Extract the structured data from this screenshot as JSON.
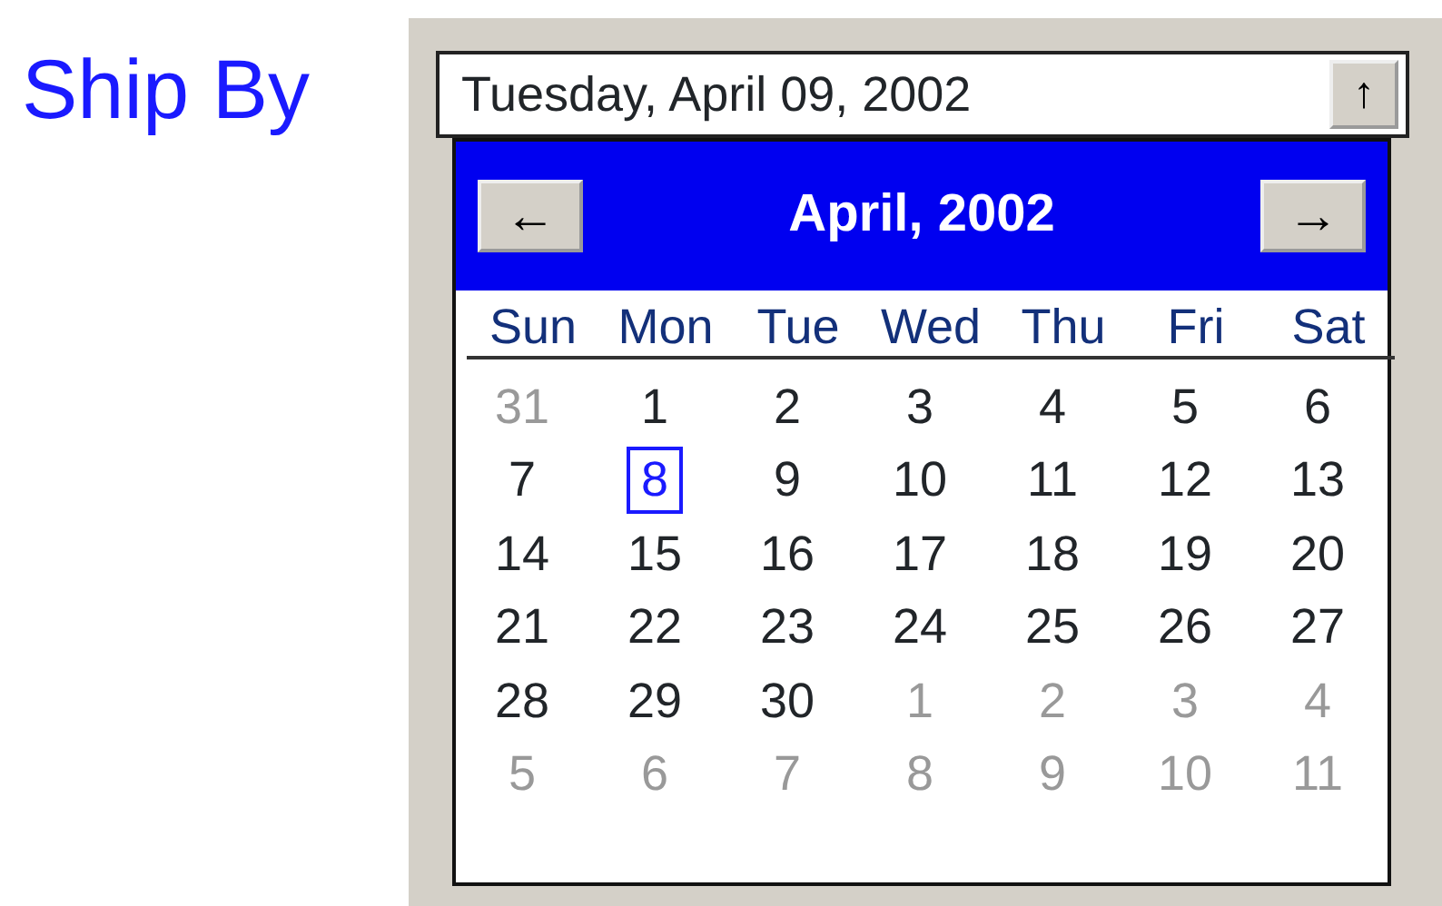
{
  "label": "Ship By",
  "field": {
    "value": "Tuesday, April 09, 2002",
    "button": "↑"
  },
  "calendar": {
    "title": "April, 2002",
    "prev": "←",
    "next": "→",
    "weekdays": [
      "Sun",
      "Mon",
      "Tue",
      "Wed",
      "Thu",
      "Fri",
      "Sat"
    ],
    "days": [
      {
        "text": "31",
        "muted": true,
        "today": false
      },
      {
        "text": "1",
        "muted": false,
        "today": false
      },
      {
        "text": "2",
        "muted": false,
        "today": false
      },
      {
        "text": "3",
        "muted": false,
        "today": false
      },
      {
        "text": "4",
        "muted": false,
        "today": false
      },
      {
        "text": "5",
        "muted": false,
        "today": false
      },
      {
        "text": "6",
        "muted": false,
        "today": false
      },
      {
        "text": "7",
        "muted": false,
        "today": false
      },
      {
        "text": "8",
        "muted": false,
        "today": true
      },
      {
        "text": "9",
        "muted": false,
        "today": false
      },
      {
        "text": "10",
        "muted": false,
        "today": false
      },
      {
        "text": "11",
        "muted": false,
        "today": false
      },
      {
        "text": "12",
        "muted": false,
        "today": false
      },
      {
        "text": "13",
        "muted": false,
        "today": false
      },
      {
        "text": "14",
        "muted": false,
        "today": false
      },
      {
        "text": "15",
        "muted": false,
        "today": false
      },
      {
        "text": "16",
        "muted": false,
        "today": false
      },
      {
        "text": "17",
        "muted": false,
        "today": false
      },
      {
        "text": "18",
        "muted": false,
        "today": false
      },
      {
        "text": "19",
        "muted": false,
        "today": false
      },
      {
        "text": "20",
        "muted": false,
        "today": false
      },
      {
        "text": "21",
        "muted": false,
        "today": false
      },
      {
        "text": "22",
        "muted": false,
        "today": false
      },
      {
        "text": "23",
        "muted": false,
        "today": false
      },
      {
        "text": "24",
        "muted": false,
        "today": false
      },
      {
        "text": "25",
        "muted": false,
        "today": false
      },
      {
        "text": "26",
        "muted": false,
        "today": false
      },
      {
        "text": "27",
        "muted": false,
        "today": false
      },
      {
        "text": "28",
        "muted": false,
        "today": false
      },
      {
        "text": "29",
        "muted": false,
        "today": false
      },
      {
        "text": "30",
        "muted": false,
        "today": false
      },
      {
        "text": "1",
        "muted": true,
        "today": false
      },
      {
        "text": "2",
        "muted": true,
        "today": false
      },
      {
        "text": "3",
        "muted": true,
        "today": false
      },
      {
        "text": "4",
        "muted": true,
        "today": false
      },
      {
        "text": "5",
        "muted": true,
        "today": false
      },
      {
        "text": "6",
        "muted": true,
        "today": false
      },
      {
        "text": "7",
        "muted": true,
        "today": false
      },
      {
        "text": "8",
        "muted": true,
        "today": false
      },
      {
        "text": "9",
        "muted": true,
        "today": false
      },
      {
        "text": "10",
        "muted": true,
        "today": false
      },
      {
        "text": "11",
        "muted": true,
        "today": false
      }
    ]
  }
}
